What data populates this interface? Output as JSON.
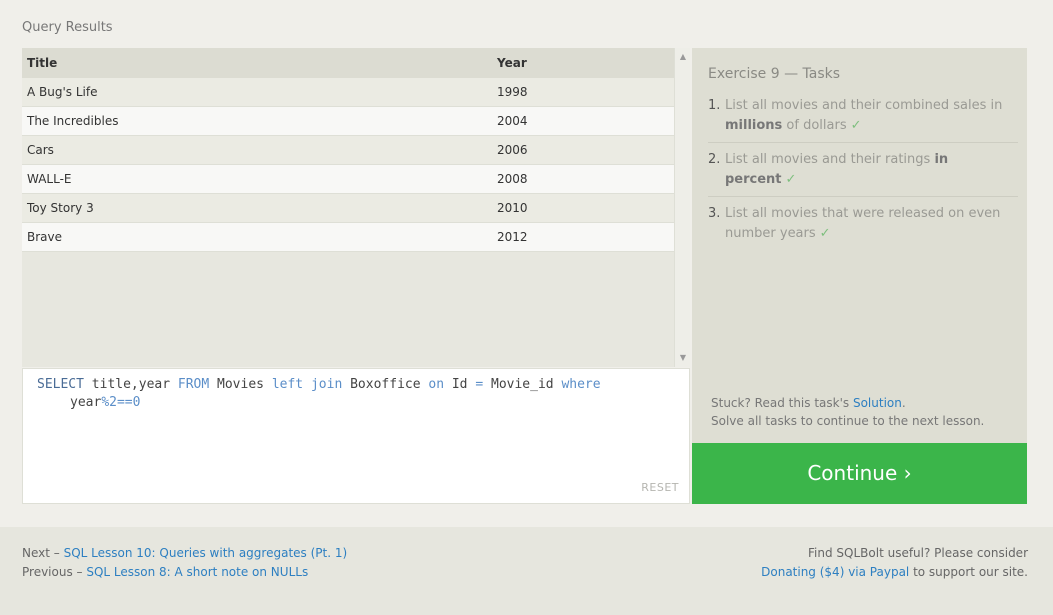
{
  "results": {
    "label": "Query Results",
    "columns": [
      "Title",
      "Year"
    ],
    "rows": [
      {
        "title": "A Bug's Life",
        "year": "1998"
      },
      {
        "title": "The Incredibles",
        "year": "2004"
      },
      {
        "title": "Cars",
        "year": "2006"
      },
      {
        "title": "WALL-E",
        "year": "2008"
      },
      {
        "title": "Toy Story 3",
        "year": "2010"
      },
      {
        "title": "Brave",
        "year": "2012"
      }
    ]
  },
  "editor": {
    "tokens_line1": [
      {
        "text": "SELECT",
        "cls": "kw-dark"
      },
      {
        "text": " title,year ",
        "cls": ""
      },
      {
        "text": "FROM",
        "cls": "kw"
      },
      {
        "text": " Movies ",
        "cls": ""
      },
      {
        "text": "left join",
        "cls": "kw"
      },
      {
        "text": " Boxoffice ",
        "cls": ""
      },
      {
        "text": "on",
        "cls": "kw"
      },
      {
        "text": " Id ",
        "cls": ""
      },
      {
        "text": "=",
        "cls": "kw"
      },
      {
        "text": " Movie_id ",
        "cls": ""
      },
      {
        "text": "where",
        "cls": "kw"
      }
    ],
    "tokens_line2": [
      {
        "text": "year",
        "cls": ""
      },
      {
        "text": "%2==0",
        "cls": "kw"
      }
    ],
    "reset_label": "RESET"
  },
  "tasks": {
    "title": "Exercise 9 — Tasks",
    "items": [
      {
        "num": "1.",
        "parts": [
          {
            "t": "List all movies and their combined sales in "
          },
          {
            "t": "millions",
            "b": true
          },
          {
            "t": " of dollars"
          }
        ],
        "check": "✓"
      },
      {
        "num": "2.",
        "parts": [
          {
            "t": "List all movies and their ratings "
          },
          {
            "t": "in percent",
            "b": true
          }
        ],
        "check": "✓"
      },
      {
        "num": "3.",
        "parts": [
          {
            "t": "List all movies that were released on even number years"
          }
        ],
        "check": "✓"
      }
    ],
    "stuck_prefix": "Stuck? Read this task's ",
    "solution_link": "Solution",
    "stuck_suffix": ".",
    "solve_all": "Solve all tasks to continue to the next lesson.",
    "continue_label": "Continue ›"
  },
  "footer": {
    "next_prefix": "Next – ",
    "next_link": "SQL Lesson 10: Queries with aggregates (Pt. 1)",
    "prev_prefix": "Previous – ",
    "prev_link": "SQL Lesson 8: A short note on NULLs",
    "right_line1": "Find SQLBolt useful? Please consider",
    "donate_link": "Donating ($4) via Paypal",
    "right_suffix": " to support our site."
  },
  "colors": {
    "accent_green": "#3bb54a",
    "link_blue": "#2d7fc1",
    "check_green": "#7ebf7e"
  }
}
